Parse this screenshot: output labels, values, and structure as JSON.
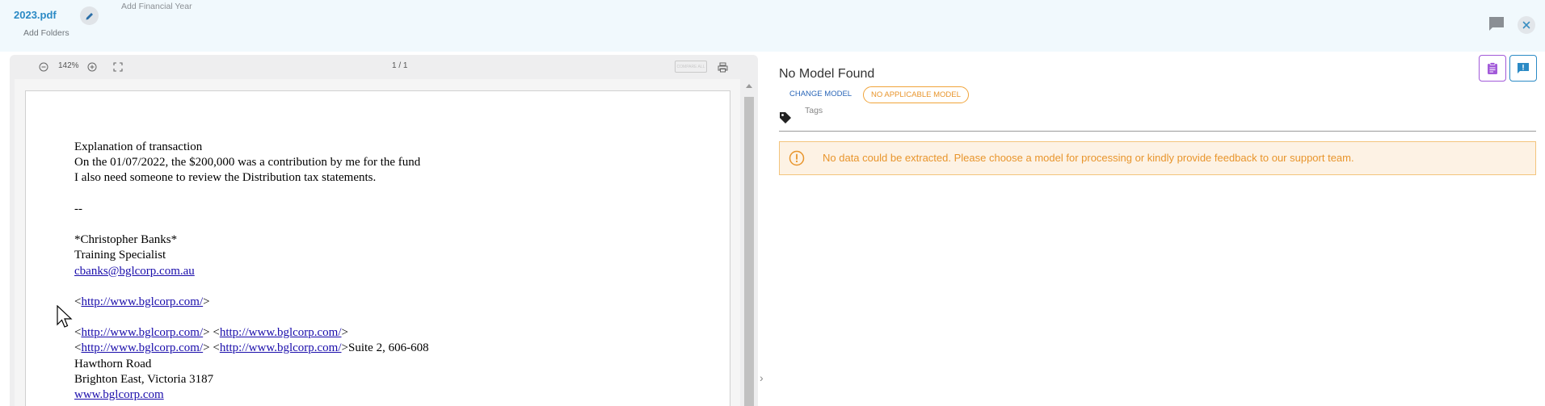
{
  "header": {
    "file_name": "2023.pdf",
    "add_financial_year": "Add Financial Year",
    "add_folders": "Add Folders"
  },
  "viewer": {
    "zoom_level": "142%",
    "page_count": "1 / 1",
    "compare_label": "COMPARE ALL",
    "document_lines": {
      "l1": "Explanation of transaction",
      "l2": "On the 01/07/2022, the $200,000 was a contribution by me for the fund",
      "l3": "I also need someone to review the Distribution tax statements.",
      "l4": "--",
      "l5": "*Christopher Banks*",
      "l6": "Training Specialist",
      "email": "cbanks@bglcorp.com.au",
      "url": "http://www.bglcorp.com/",
      "suite": "Suite 2, 606-608",
      "street": "Hawthorn Road",
      "city": "Brighton East, Victoria 3187",
      "website": "www.bglcorp.com"
    }
  },
  "panel": {
    "model_title": "No Model Found",
    "change_model": "CHANGE MODEL",
    "no_model_badge": "NO APPLICABLE MODEL",
    "tags_label": "Tags",
    "warning_text": "No data could be extracted. Please choose a model for processing or kindly provide feedback to our support team."
  },
  "icons": {
    "edit": "pencil-icon",
    "comment": "comment-icon",
    "close": "close-icon",
    "zoom_out": "zoom-out-icon",
    "zoom_in": "zoom-in-icon",
    "fullscreen": "fullscreen-icon",
    "print": "print-icon",
    "tag": "tag-icon",
    "warning": "exclamation-circle-icon",
    "clipboard": "clipboard-icon",
    "feedback": "feedback-icon"
  },
  "colors": {
    "header_bg": "#f1f9fd",
    "link_blue": "#2b8ac5",
    "warning_orange": "#e8952c",
    "warning_bg": "#fdf2e4",
    "purple": "#a25ad9"
  }
}
